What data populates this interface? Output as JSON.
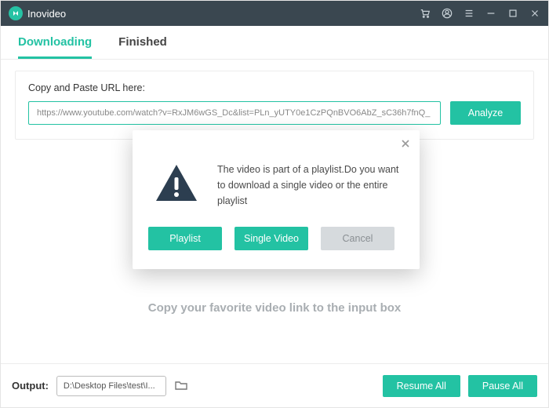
{
  "titlebar": {
    "app_name": "Inovideo"
  },
  "tabs": {
    "downloading": "Downloading",
    "finished": "Finished"
  },
  "url_card": {
    "label": "Copy and Paste URL here:",
    "value": "https://www.youtube.com/watch?v=RxJM6wGS_Dc&list=PLn_yUTY0e1CzPQnBVO6AbZ_sC36h7fnQ_",
    "analyze": "Analyze"
  },
  "hint": "Copy your favorite video link to the input box",
  "bottom": {
    "output_label": "Output:",
    "output_path": "D:\\Desktop Files\\test\\I...",
    "resume": "Resume All",
    "pause": "Pause All"
  },
  "modal": {
    "message": "The video is part of a playlist.Do you want to download a single video or the entire playlist",
    "playlist": "Playlist",
    "single": "Single Video",
    "cancel": "Cancel"
  }
}
